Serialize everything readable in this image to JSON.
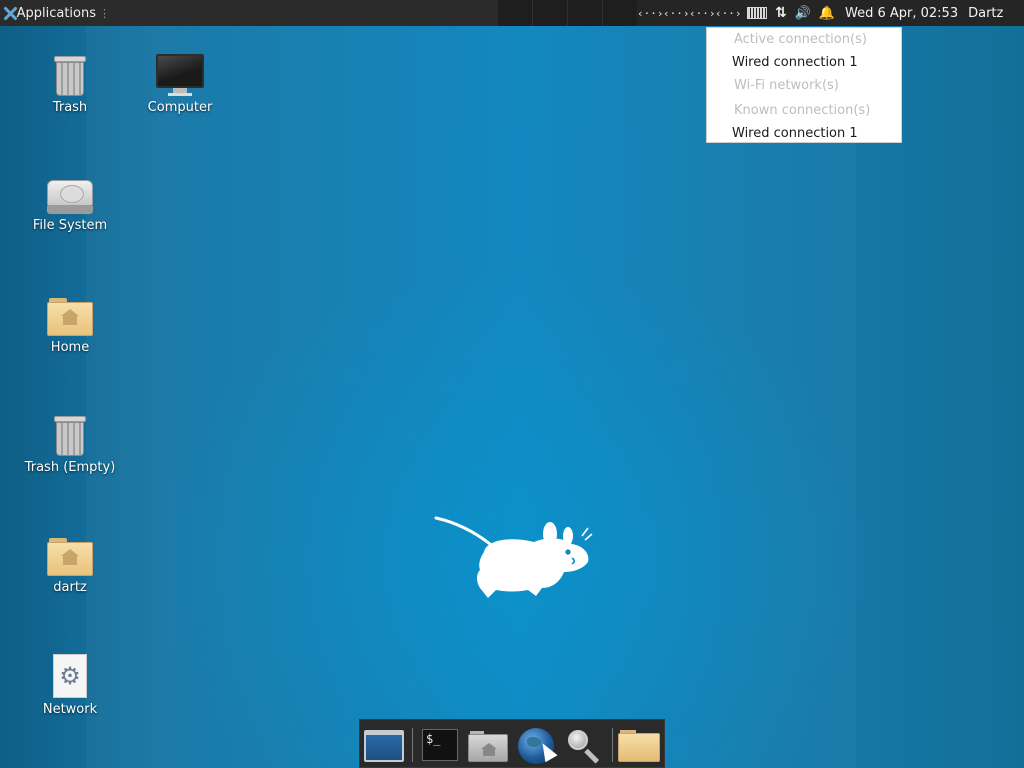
{
  "panel": {
    "applications_label": "Applications",
    "applications_grip": "⋮",
    "net_glyph": "‹··›",
    "updown_glyph": "⇅",
    "volume_glyph": "🔊",
    "bell_glyph": "🔔",
    "clock": "Wed  6 Apr, 02:53",
    "user": "Dartz"
  },
  "network_menu": {
    "active_header": "Active connection(s)",
    "active_item": "Wired connection 1",
    "wifi_header": "Wi-Fi network(s)",
    "known_header": "Known connection(s)",
    "known_item": "Wired connection 1"
  },
  "desktop_icons": {
    "trash": "Trash",
    "computer": "Computer",
    "file_system": "File System",
    "home": "Home",
    "trash_empty": "Trash (Empty)",
    "dartz": "dartz",
    "network": "Network"
  },
  "dock": {
    "terminal_prompt": "$_"
  },
  "colors": {
    "panel_bg": "#2b2b2b",
    "desktop_blue": "#0e86bf",
    "menu_bg": "#ffffff",
    "menu_disabled_text": "#bdbdbd"
  }
}
